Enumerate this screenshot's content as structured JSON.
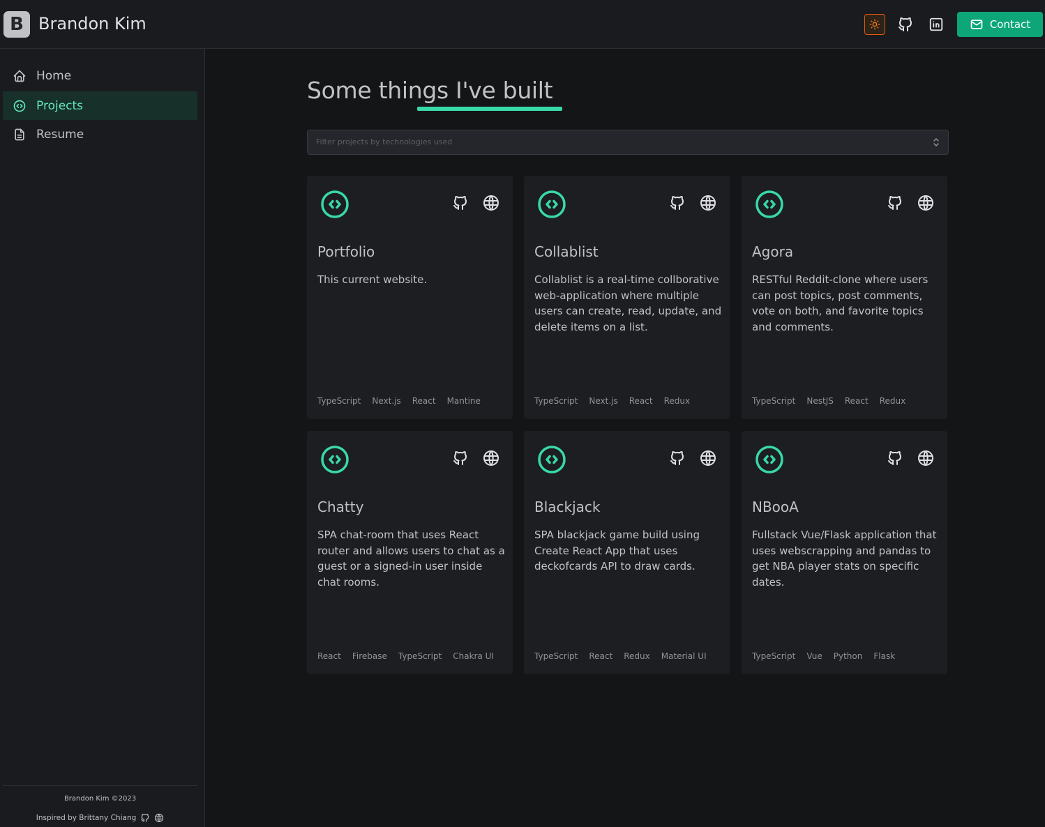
{
  "header": {
    "logo_letter": "B",
    "brand": "Brandon Kim",
    "contact_label": "Contact"
  },
  "sidebar": {
    "items": [
      {
        "label": "Home",
        "icon": "home-icon"
      },
      {
        "label": "Projects",
        "icon": "code-circle-icon",
        "active": true
      },
      {
        "label": "Resume",
        "icon": "file-icon"
      }
    ],
    "copyright": "Brandon Kim ©2023",
    "inspired": "Inspired by Brittany Chiang"
  },
  "main": {
    "heading": "Some things I've built",
    "filter_placeholder": "Filter projects by technologies used",
    "projects": [
      {
        "title": "Portfolio",
        "description": "This current website.",
        "tags": [
          "TypeScript",
          "Next.js",
          "React",
          "Mantine"
        ]
      },
      {
        "title": "Collablist",
        "description": "Collablist is a real-time collborative web-application where multiple users can create, read, update, and delete items on a list.",
        "tags": [
          "TypeScript",
          "Next.js",
          "React",
          "Redux"
        ]
      },
      {
        "title": "Agora",
        "description": "RESTful Reddit-clone where users can post topics, post comments, vote on both, and favorite topics and comments.",
        "tags": [
          "TypeScript",
          "NestJS",
          "React",
          "Redux"
        ]
      },
      {
        "title": "Chatty",
        "description": "SPA chat-room that uses React router and allows users to chat as a guest or a signed-in user inside chat rooms.",
        "tags": [
          "React",
          "Firebase",
          "TypeScript",
          "Chakra UI"
        ]
      },
      {
        "title": "Blackjack",
        "description": "SPA blackjack game build using Create React App that uses deckofcards API to draw cards.",
        "tags": [
          "TypeScript",
          "React",
          "Redux",
          "Material UI"
        ]
      },
      {
        "title": "NBooA",
        "description": "Fullstack Vue/Flask application that uses webscrapping and pandas to get NBA player stats on specific dates.",
        "tags": [
          "TypeScript",
          "Vue",
          "Python",
          "Flask"
        ]
      }
    ]
  },
  "colors": {
    "accent": "#38d9a9",
    "contact": "#0ca678",
    "theme_toggle": "#e8590c"
  }
}
